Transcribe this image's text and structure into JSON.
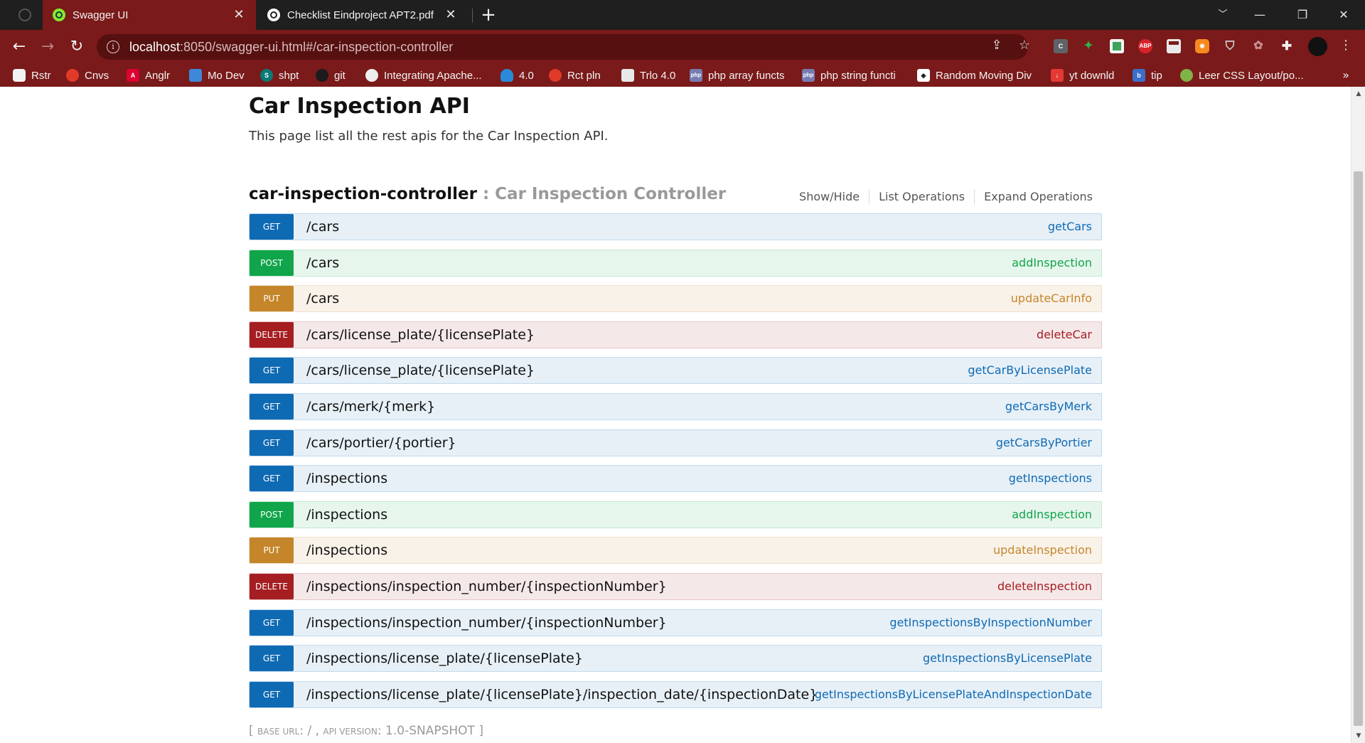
{
  "browser": {
    "tabs": [
      {
        "title": "Swagger UI",
        "active": true
      },
      {
        "title": "Checklist Eindproject APT2.pdf",
        "active": false
      }
    ],
    "url_host": "localhost",
    "url_rest": ":8050/swagger-ui.html#/car-inspection-controller",
    "extensions": [
      "C",
      "ABP"
    ],
    "bookmarks": [
      {
        "label": "Rstr",
        "icon": "rstr-icon"
      },
      {
        "label": "Cnvs",
        "icon": "canvas-icon"
      },
      {
        "label": "Anglr",
        "icon": "angular-icon"
      },
      {
        "label": "Mo Dev",
        "icon": "flutter-icon"
      },
      {
        "label": "shpt",
        "icon": "sharepoint-icon"
      },
      {
        "label": "git",
        "icon": "github-icon"
      },
      {
        "label": "Integrating Apache...",
        "icon": "globe-icon"
      },
      {
        "label": "4.0",
        "icon": "cloud-icon"
      },
      {
        "label": "Rct pln",
        "icon": "react-icon"
      },
      {
        "label": "Trlo 4.0",
        "icon": "trello-icon"
      },
      {
        "label": "php array functs",
        "icon": "php-icon"
      },
      {
        "label": "php string functi",
        "icon": "php-icon"
      },
      {
        "label": "Random Moving Div",
        "icon": "codepen-icon"
      },
      {
        "label": "yt downld",
        "icon": "download-icon"
      },
      {
        "label": "tip",
        "icon": "bootstrap-icon"
      },
      {
        "label": "Leer CSS Layout/po...",
        "icon": "globe-icon"
      }
    ],
    "more_bookmarks": "»"
  },
  "page": {
    "title": "Car Inspection API",
    "description": "This page list all the rest apis for the Car Inspection API.",
    "resource": {
      "name": "car-inspection-controller",
      "desc": " : Car Inspection Controller",
      "actions": [
        "Show/Hide",
        "List Operations",
        "Expand Operations"
      ]
    },
    "operations": [
      {
        "method": "GET",
        "path": "/cars",
        "nickname": "getCars"
      },
      {
        "method": "POST",
        "path": "/cars",
        "nickname": "addInspection"
      },
      {
        "method": "PUT",
        "path": "/cars",
        "nickname": "updateCarInfo"
      },
      {
        "method": "DELETE",
        "path": "/cars/license_plate/{licensePlate}",
        "nickname": "deleteCar"
      },
      {
        "method": "GET",
        "path": "/cars/license_plate/{licensePlate}",
        "nickname": "getCarByLicensePlate"
      },
      {
        "method": "GET",
        "path": "/cars/merk/{merk}",
        "nickname": "getCarsByMerk"
      },
      {
        "method": "GET",
        "path": "/cars/portier/{portier}",
        "nickname": "getCarsByPortier"
      },
      {
        "method": "GET",
        "path": "/inspections",
        "nickname": "getInspections"
      },
      {
        "method": "POST",
        "path": "/inspections",
        "nickname": "addInspection"
      },
      {
        "method": "PUT",
        "path": "/inspections",
        "nickname": "updateInspection"
      },
      {
        "method": "DELETE",
        "path": "/inspections/inspection_number/{inspectionNumber}",
        "nickname": "deleteInspection"
      },
      {
        "method": "GET",
        "path": "/inspections/inspection_number/{inspectionNumber}",
        "nickname": "getInspectionsByInspectionNumber"
      },
      {
        "method": "GET",
        "path": "/inspections/license_plate/{licensePlate}",
        "nickname": "getInspectionsByLicensePlate"
      },
      {
        "method": "GET",
        "path": "/inspections/license_plate/{licensePlate}/inspection_date/{inspectionDate}",
        "nickname": "getInspectionsByLicensePlateAndInspectionDate"
      }
    ],
    "footer": {
      "open": "[ ",
      "base_url_label": "BASE URL",
      "base_url_value": ": / , ",
      "api_version_label": "API VERSION",
      "api_version_value": ": 1.0-SNAPSHOT ]"
    }
  },
  "colors": {
    "chrome_dark": "#1f1f1f",
    "chrome_red": "#7a1a1a",
    "get": "#0f6ab4",
    "post": "#10a54a",
    "put": "#c5862b",
    "delete": "#a41e22"
  }
}
